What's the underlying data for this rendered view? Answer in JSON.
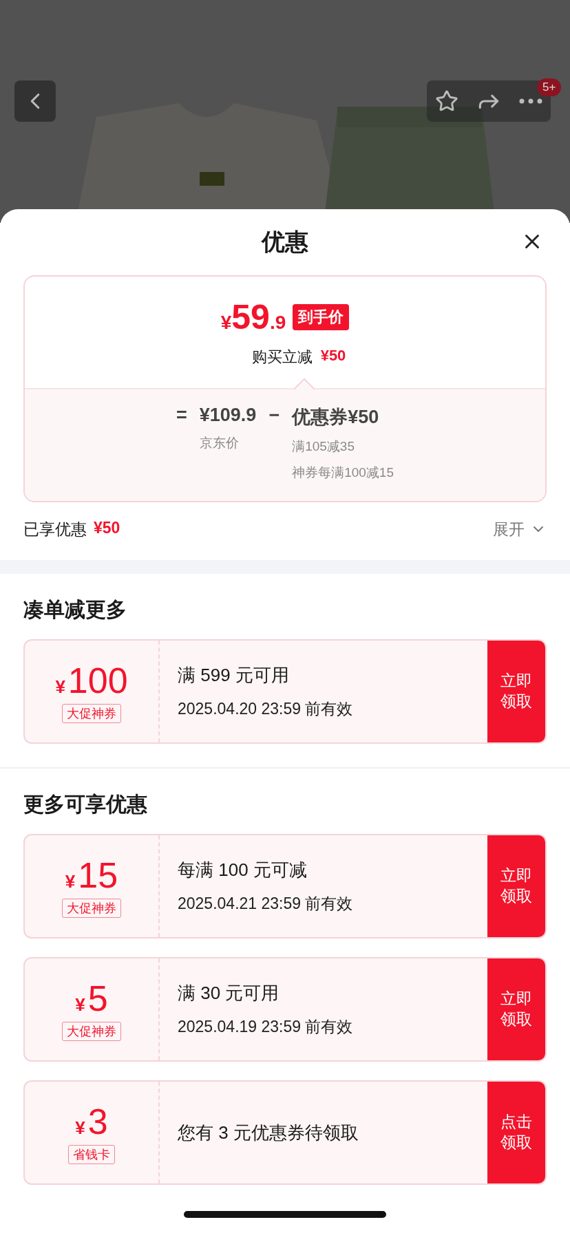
{
  "top_bar": {
    "badge": "5+"
  },
  "sheet": {
    "title": "优惠"
  },
  "price_card": {
    "currency": "¥",
    "price_main": "59",
    "price_decimal": ".9",
    "price_tag": "到手价",
    "instant_label": "购买立减",
    "instant_amount": "¥50",
    "formula": {
      "equals": "=",
      "base_price": "¥109.9",
      "base_label": "京东价",
      "minus": "−",
      "discount": "优惠券¥50",
      "details": [
        "满105减35",
        "神券每满100减15"
      ]
    }
  },
  "summary": {
    "label": "已享优惠",
    "amount": "¥50",
    "expand": "展开"
  },
  "sections": [
    {
      "title": "凑单减更多",
      "coupons": [
        {
          "currency": "¥",
          "amount": "100",
          "tag": "大促神券",
          "condition": "满 599 元可用",
          "expiry": "2025.04.20 23:59 前有效",
          "action": "立即领取"
        }
      ]
    },
    {
      "title": "更多可享优惠",
      "coupons": [
        {
          "currency": "¥",
          "amount": "15",
          "tag": "大促神券",
          "condition": "每满 100 元可减",
          "expiry": "2025.04.21 23:59 前有效",
          "action": "立即领取"
        },
        {
          "currency": "¥",
          "amount": "5",
          "tag": "大促神券",
          "condition": "满 30 元可用",
          "expiry": "2025.04.19 23:59 前有效",
          "action": "立即领取"
        },
        {
          "currency": "¥",
          "amount": "3",
          "tag": "省钱卡",
          "condition": "您有 3 元优惠券待领取",
          "action": "点击领取"
        }
      ]
    }
  ]
}
